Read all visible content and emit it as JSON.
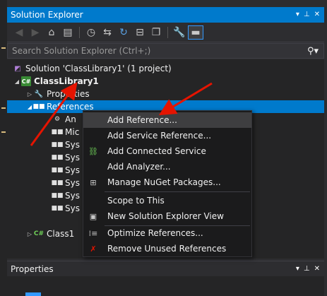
{
  "solution_explorer": {
    "title": "Solution Explorer",
    "title_buttons": [
      "▾",
      "⊥",
      "✕"
    ],
    "search_placeholder": "Search Solution Explorer (Ctrl+;)",
    "toolbar_icons": [
      "back-icon",
      "forward-icon",
      "home-icon",
      "switch-views-icon",
      "history-icon",
      "sync-icon",
      "refresh-icon",
      "collapse-all-icon",
      "show-all-files-icon",
      "properties-icon",
      "preview-icon"
    ]
  },
  "tree": {
    "solution": "Solution 'ClassLibrary1' (1 project)",
    "project": "ClassLibrary1",
    "properties": "Properties",
    "references": "References",
    "ref_items": [
      "An",
      "Mic",
      "Sys",
      "Sys",
      "Sys",
      "Sys",
      "Sys",
      "Sys"
    ],
    "class_file": "Class1"
  },
  "context_menu": {
    "items": [
      {
        "label": "Add Reference...",
        "icon": ""
      },
      {
        "label": "Add Service Reference...",
        "icon": ""
      },
      {
        "label": "Add Connected Service",
        "icon": "connected-service-icon"
      },
      {
        "label": "Add Analyzer...",
        "icon": ""
      },
      {
        "label": "Manage NuGet Packages...",
        "icon": "nuget-icon"
      },
      {
        "label": "Scope to This",
        "icon": ""
      },
      {
        "label": "New Solution Explorer View",
        "icon": "new-view-icon"
      },
      {
        "label": "Optimize References...",
        "icon": "optimize-icon"
      },
      {
        "label": "Remove Unused References",
        "icon": "remove-unused-icon"
      }
    ]
  },
  "properties_window": {
    "title": "Properties",
    "title_buttons": [
      "▾",
      "⊥",
      "✕"
    ]
  },
  "colors": {
    "accent": "#007acc",
    "annotation": "#e51400"
  }
}
